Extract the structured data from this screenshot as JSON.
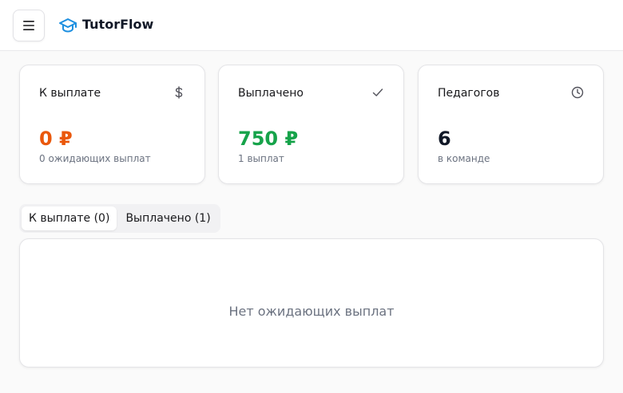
{
  "header": {
    "brand": "TutorFlow",
    "menu_icon": "hamburger-icon",
    "logo_icon": "graduation-cap-icon",
    "brand_color": "#1d8fe0"
  },
  "stats": [
    {
      "label": "К выплате",
      "value": "0 ₽",
      "sub": "0 ожидающих выплат",
      "icon": "dollar-icon",
      "value_color": "#ea580c"
    },
    {
      "label": "Выплачено",
      "value": "750 ₽",
      "sub": "1 выплат",
      "icon": "check-icon",
      "value_color": "#16a34a"
    },
    {
      "label": "Педагогов",
      "value": "6",
      "sub": "в команде",
      "icon": "clock-icon",
      "value_color": "#111827"
    }
  ],
  "tabs": [
    {
      "label": "К выплате (0)",
      "active": true
    },
    {
      "label": "Выплачено (1)",
      "active": false
    }
  ],
  "panel": {
    "empty_message": "Нет ожидающих выплат"
  }
}
